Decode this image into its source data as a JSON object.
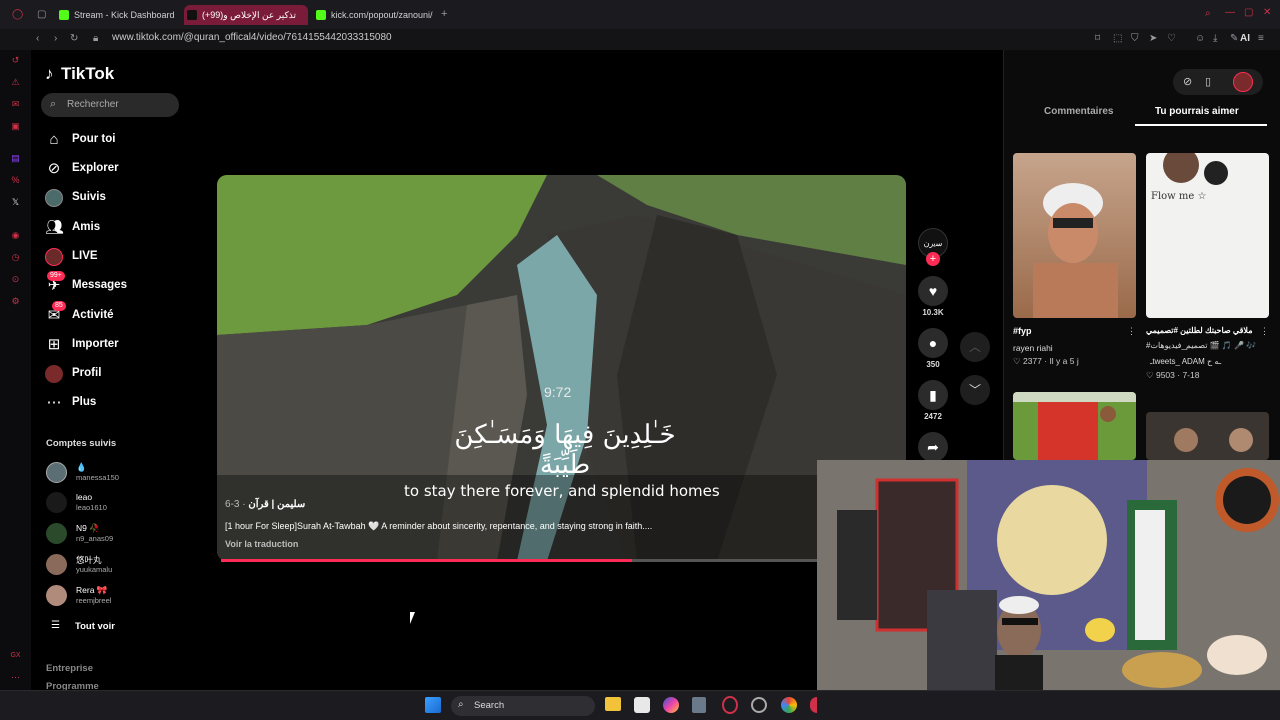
{
  "browser": {
    "tabs": [
      {
        "label": "Stream - Kick Dashboard",
        "favicon_color": "#53fc18"
      },
      {
        "label": "(+99)تذكير عن الإخلاص و",
        "favicon_color": "#ffffff"
      },
      {
        "label": "kick.com/popout/zanouni/c",
        "favicon_color": "#53fc18"
      }
    ],
    "url": "www.tiktok.com/@quran_offical4/video/7614155442033315080",
    "ai_label": "AI"
  },
  "tiktok": {
    "logo": "TikTok",
    "search_placeholder": "Rechercher",
    "nav": [
      {
        "label": "Pour toi",
        "icon": "home-icon"
      },
      {
        "label": "Explorer",
        "icon": "compass-icon"
      },
      {
        "label": "Suivis",
        "icon": "following-avatar-icon"
      },
      {
        "label": "Amis",
        "icon": "friends-icon"
      },
      {
        "label": "LIVE",
        "icon": "live-icon"
      },
      {
        "label": "Messages",
        "icon": "messages-icon",
        "badge": "99+"
      },
      {
        "label": "Activité",
        "icon": "activity-icon",
        "badge": "85"
      },
      {
        "label": "Importer",
        "icon": "upload-icon"
      },
      {
        "label": "Profil",
        "icon": "profile-avatar-icon"
      },
      {
        "label": "Plus",
        "icon": "more-icon"
      }
    ],
    "following_title": "Comptes suivis",
    "following": [
      {
        "name": "💧",
        "handle": "manessa150"
      },
      {
        "name": "leao",
        "handle": "leao1610"
      },
      {
        "name": "N9 🥀",
        "handle": "n9_anas09"
      },
      {
        "name": "悠叶丸",
        "handle": "yuukamalu"
      },
      {
        "name": "Rera 🎀",
        "handle": "reemjbreel"
      }
    ],
    "see_all": "Tout voir",
    "footer_1": "Entreprise",
    "footer_2": "Programme"
  },
  "video": {
    "timer": "9:72",
    "arabic_caption": "خَـٰلِدِينَ فِيهَا وَمَسَـٰكِنَ طَيِّبَةً",
    "subtitle": "to stay there forever, and splendid homes",
    "author": "سليمن | قرآن",
    "date": " · 3-6",
    "description": "[1 hour For Sleep]Surah At-Tawbah 🤍 A reminder about sincerity, repentance, and staying strong in faith....",
    "translate": "Voir la traduction",
    "progress": 0.69,
    "likes": "10.3K",
    "comments": "350",
    "saves": "2472"
  },
  "right_panel": {
    "tab_comments": "Commentaires",
    "tab_suggested": "Tu pourrais aimer",
    "cards": [
      {
        "title": "#fyp",
        "user": "rayen riahi",
        "meta": "♡ 2377 · Il y a 5 j",
        "thumb_text": ""
      },
      {
        "title": "ملاقي صاحبتك لطلتين #تصميمي",
        "user": "#تصميم_فيديوهات 🎬 🎵 🎤 🎶",
        "meta": "♡ 9503 · 7-18",
        "user2": "ـtweets_ ADAM ـه ح",
        "thumb_text": "Flow me ☆"
      }
    ]
  },
  "taskbar": {
    "search": "Search"
  }
}
